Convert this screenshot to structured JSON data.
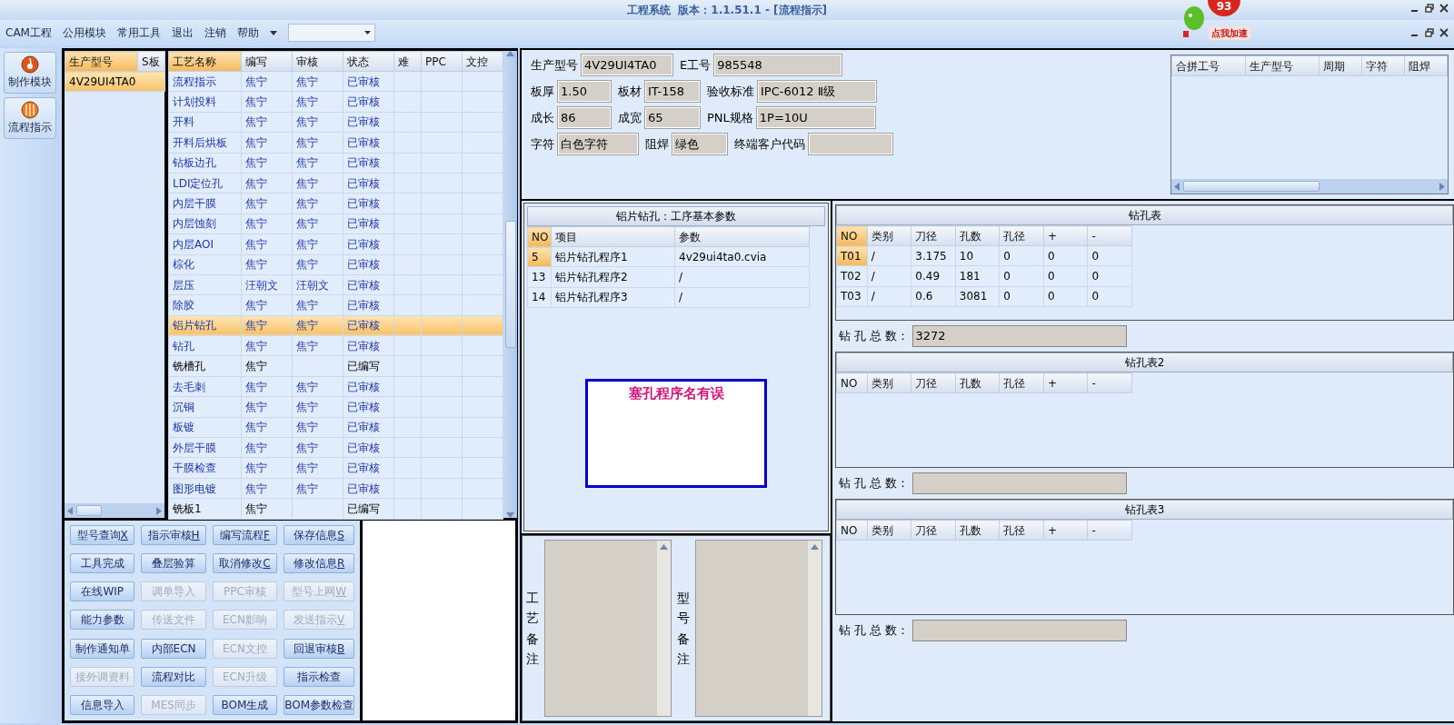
{
  "window": {
    "title": "工程系统  版本：1.1.51.1 - [流程指示]"
  },
  "promo": {
    "count": "93",
    "label": "点我加速"
  },
  "menu": {
    "items": [
      "CAM工程",
      "公用模块",
      "常用工具",
      "退出",
      "注销",
      "帮助"
    ]
  },
  "modules": [
    {
      "label": "制作模块"
    },
    {
      "label": "流程指示"
    }
  ],
  "model_list": {
    "columns": [
      {
        "label": "生产型号",
        "highlighted": true
      },
      {
        "label": "S板",
        "highlighted": false
      }
    ],
    "rows": [
      {
        "model": "4V29UI4TA0",
        "selected": true
      }
    ]
  },
  "process_table": {
    "columns": [
      {
        "label": "工艺名称",
        "highlighted": true
      },
      {
        "label": "编写",
        "highlighted": false
      },
      {
        "label": "审核",
        "highlighted": false
      },
      {
        "label": "状态",
        "highlighted": false
      },
      {
        "label": "难",
        "highlighted": false
      },
      {
        "label": "PPC",
        "highlighted": false
      },
      {
        "label": "文控",
        "highlighted": false
      }
    ],
    "rows": [
      {
        "step": "流程指示",
        "author": "焦宁",
        "reviewer": "焦宁",
        "status": "已审核",
        "kind": "approved",
        "selected": false
      },
      {
        "step": "计划投料",
        "author": "焦宁",
        "reviewer": "焦宁",
        "status": "已审核",
        "kind": "approved",
        "selected": false
      },
      {
        "step": "开料",
        "author": "焦宁",
        "reviewer": "焦宁",
        "status": "已审核",
        "kind": "approved",
        "selected": false
      },
      {
        "step": "开料后烘板",
        "author": "焦宁",
        "reviewer": "焦宁",
        "status": "已审核",
        "kind": "approved",
        "selected": false
      },
      {
        "step": "钻板边孔",
        "author": "焦宁",
        "reviewer": "焦宁",
        "status": "已审核",
        "kind": "approved",
        "selected": false
      },
      {
        "step": "LDI定位孔",
        "author": "焦宁",
        "reviewer": "焦宁",
        "status": "已审核",
        "kind": "approved",
        "selected": false
      },
      {
        "step": "内层干膜",
        "author": "焦宁",
        "reviewer": "焦宁",
        "status": "已审核",
        "kind": "approved",
        "selected": false
      },
      {
        "step": "内层蚀刻",
        "author": "焦宁",
        "reviewer": "焦宁",
        "status": "已审核",
        "kind": "approved",
        "selected": false
      },
      {
        "step": "内层AOI",
        "author": "焦宁",
        "reviewer": "焦宁",
        "status": "已审核",
        "kind": "approved",
        "selected": false
      },
      {
        "step": "棕化",
        "author": "焦宁",
        "reviewer": "焦宁",
        "status": "已审核",
        "kind": "approved",
        "selected": false
      },
      {
        "step": "层压",
        "author": "汪朝文",
        "reviewer": "汪朝文",
        "status": "已审核",
        "kind": "approved",
        "selected": false
      },
      {
        "step": "除胶",
        "author": "焦宁",
        "reviewer": "焦宁",
        "status": "已审核",
        "kind": "approved",
        "selected": false
      },
      {
        "step": "铝片钻孔",
        "author": "焦宁",
        "reviewer": "焦宁",
        "status": "已审核",
        "kind": "approved",
        "selected": true
      },
      {
        "step": "钻孔",
        "author": "焦宁",
        "reviewer": "焦宁",
        "status": "已审核",
        "kind": "approved",
        "selected": false
      },
      {
        "step": "铣槽孔",
        "author": "焦宁",
        "status": "已编写",
        "kind": "written",
        "selected": false
      },
      {
        "step": "去毛刺",
        "author": "焦宁",
        "reviewer": "焦宁",
        "status": "已审核",
        "kind": "approved",
        "selected": false
      },
      {
        "step": "沉铜",
        "author": "焦宁",
        "reviewer": "焦宁",
        "status": "已审核",
        "kind": "approved",
        "selected": false
      },
      {
        "step": "板镀",
        "author": "焦宁",
        "reviewer": "焦宁",
        "status": "已审核",
        "kind": "approved",
        "selected": false
      },
      {
        "step": "外层干膜",
        "author": "焦宁",
        "reviewer": "焦宁",
        "status": "已审核",
        "kind": "approved",
        "selected": false
      },
      {
        "step": "干膜检查",
        "author": "焦宁",
        "reviewer": "焦宁",
        "status": "已审核",
        "kind": "approved",
        "selected": false
      },
      {
        "step": "图形电镀",
        "author": "焦宁",
        "reviewer": "焦宁",
        "status": "已审核",
        "kind": "approved",
        "selected": false
      },
      {
        "step": "铣板1",
        "author": "焦宁",
        "status": "已编写",
        "kind": "written",
        "selected": false
      }
    ]
  },
  "buttons": [
    {
      "label": "型号查询",
      "hotkey": "X",
      "disabled": false
    },
    {
      "label": "指示审核",
      "hotkey": "H",
      "disabled": false
    },
    {
      "label": "编写流程",
      "hotkey": "F",
      "disabled": false
    },
    {
      "label": "保存信息",
      "hotkey": "S",
      "disabled": false
    },
    {
      "label": "工具完成",
      "disabled": false
    },
    {
      "label": "叠层验算",
      "disabled": false
    },
    {
      "label": "取消修改",
      "hotkey": "C",
      "disabled": false
    },
    {
      "label": "修改信息",
      "hotkey": "R",
      "disabled": false
    },
    {
      "label": "在线WIP",
      "disabled": false
    },
    {
      "label": "调单导入",
      "disabled": true
    },
    {
      "label": "PPC审核",
      "disabled": true
    },
    {
      "label": "型号上网",
      "hotkey": "W",
      "disabled": true
    },
    {
      "label": "能力参数",
      "disabled": false
    },
    {
      "label": "传送文件",
      "disabled": true
    },
    {
      "label": "ECN影响",
      "disabled": true
    },
    {
      "label": "发送指示",
      "hotkey": "V",
      "disabled": true
    },
    {
      "label": "制作通知单",
      "disabled": false
    },
    {
      "label": "内部ECN",
      "disabled": false
    },
    {
      "label": "ECN文控",
      "disabled": true
    },
    {
      "label": "回退审核",
      "hotkey": "B",
      "disabled": false
    },
    {
      "label": "接外调资料",
      "disabled": true
    },
    {
      "label": "流程对比",
      "disabled": false
    },
    {
      "label": "ECN升级",
      "disabled": true
    },
    {
      "label": "指示检查",
      "disabled": false
    },
    {
      "label": "信息导入",
      "disabled": false
    },
    {
      "label": "MES同步",
      "disabled": true
    },
    {
      "label": "BOM生成",
      "disabled": false
    },
    {
      "label": "BOM参数检查",
      "disabled": false
    }
  ],
  "form": {
    "rows": [
      [
        {
          "label": "生产型号",
          "value": "4V29UI4TA0"
        },
        {
          "label": "E工号",
          "value": "985548"
        }
      ],
      [
        {
          "label": "板厚",
          "value": "1.50"
        },
        {
          "label": "板材",
          "value": "IT-158"
        },
        {
          "label": "验收标准",
          "value": "IPC-6012 Ⅱ级"
        }
      ],
      [
        {
          "label": "成长",
          "value": "86"
        },
        {
          "label": "成宽",
          "value": "65"
        },
        {
          "label": "PNL规格",
          "value": "1P=10U"
        }
      ],
      [
        {
          "label": "字符",
          "value": "白色字符"
        },
        {
          "label": "阻焊",
          "value": "绿色"
        },
        {
          "label": "终端客户代码"
        }
      ]
    ]
  },
  "combined_table": {
    "columns": [
      "合拼工号",
      "生产型号",
      "周期",
      "字符",
      "阻焊"
    ]
  },
  "params": {
    "title": "铝片钻孔：工序基本参数",
    "columns": [
      {
        "label": "NO",
        "highlighted": true
      },
      {
        "label": "项目",
        "highlighted": false
      },
      {
        "label": "参数",
        "highlighted": false
      }
    ],
    "rows": [
      {
        "no": "5",
        "item": "铝片钻孔程序1",
        "value": "4v29ui4ta0.cvia",
        "current": true
      },
      {
        "no": "13",
        "item": "铝片钻孔程序2",
        "value": "/",
        "current": false
      },
      {
        "no": "14",
        "item": "铝片钻孔程序3",
        "value": "/",
        "current": false
      }
    ],
    "alert": "塞孔程序名有误"
  },
  "notes": [
    {
      "label": "工艺备注"
    },
    {
      "label": "型号备注"
    }
  ],
  "drill_tables": [
    {
      "title": "钻孔表",
      "columns": [
        {
          "label": "NO",
          "highlighted": true
        },
        {
          "label": "类别",
          "highlighted": false
        },
        {
          "label": "刀径",
          "highlighted": false
        },
        {
          "label": "孔数",
          "highlighted": false
        },
        {
          "label": "孔径",
          "highlighted": false
        },
        {
          "label": "+",
          "highlighted": false
        },
        {
          "label": "-",
          "highlighted": false
        }
      ],
      "rows": [
        {
          "cells": [
            "T01",
            "/",
            "3.175",
            "10",
            "0",
            "0",
            "0"
          ],
          "current": true
        },
        {
          "cells": [
            "T02",
            "/",
            "0.49",
            "181",
            "0",
            "0",
            "0"
          ],
          "current": false
        },
        {
          "cells": [
            "T03",
            "/",
            "0.6",
            "3081",
            "0",
            "0",
            "0"
          ],
          "current": false
        }
      ],
      "total_label": "钻 孔 总 数：",
      "total": "3272"
    },
    {
      "title": "钻孔表2",
      "columns": [
        {
          "label": "NO",
          "highlighted": false
        },
        {
          "label": "类别",
          "highlighted": false
        },
        {
          "label": "刀径",
          "highlighted": false
        },
        {
          "label": "孔数",
          "highlighted": false
        },
        {
          "label": "孔径",
          "highlighted": false
        },
        {
          "label": "+",
          "highlighted": false
        },
        {
          "label": "-",
          "highlighted": false
        }
      ],
      "total_label": "钻 孔 总 数："
    },
    {
      "title": "钻孔表3",
      "columns": [
        {
          "label": "NO",
          "highlighted": false
        },
        {
          "label": "类别",
          "highlighted": false
        },
        {
          "label": "刀径",
          "highlighted": false
        },
        {
          "label": "孔数",
          "highlighted": false
        },
        {
          "label": "孔径",
          "highlighted": false
        },
        {
          "label": "+",
          "highlighted": false
        },
        {
          "label": "-",
          "highlighted": false
        }
      ],
      "total_label": "钻 孔 总 数："
    }
  ]
}
